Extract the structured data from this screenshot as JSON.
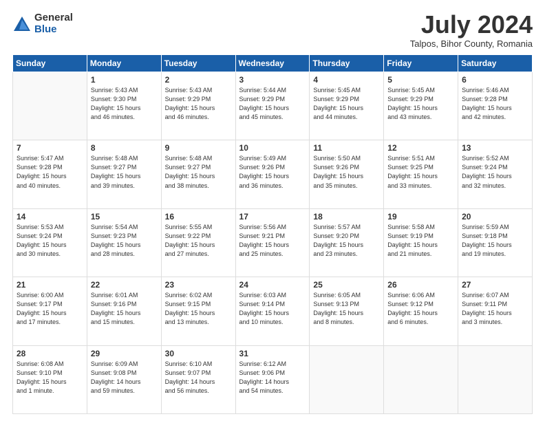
{
  "logo": {
    "general": "General",
    "blue": "Blue"
  },
  "header": {
    "month_year": "July 2024",
    "location": "Talpos, Bihor County, Romania"
  },
  "weekdays": [
    "Sunday",
    "Monday",
    "Tuesday",
    "Wednesday",
    "Thursday",
    "Friday",
    "Saturday"
  ],
  "weeks": [
    [
      {
        "day": "",
        "info": ""
      },
      {
        "day": "1",
        "info": "Sunrise: 5:43 AM\nSunset: 9:30 PM\nDaylight: 15 hours\nand 46 minutes."
      },
      {
        "day": "2",
        "info": "Sunrise: 5:43 AM\nSunset: 9:29 PM\nDaylight: 15 hours\nand 46 minutes."
      },
      {
        "day": "3",
        "info": "Sunrise: 5:44 AM\nSunset: 9:29 PM\nDaylight: 15 hours\nand 45 minutes."
      },
      {
        "day": "4",
        "info": "Sunrise: 5:45 AM\nSunset: 9:29 PM\nDaylight: 15 hours\nand 44 minutes."
      },
      {
        "day": "5",
        "info": "Sunrise: 5:45 AM\nSunset: 9:29 PM\nDaylight: 15 hours\nand 43 minutes."
      },
      {
        "day": "6",
        "info": "Sunrise: 5:46 AM\nSunset: 9:28 PM\nDaylight: 15 hours\nand 42 minutes."
      }
    ],
    [
      {
        "day": "7",
        "info": "Sunrise: 5:47 AM\nSunset: 9:28 PM\nDaylight: 15 hours\nand 40 minutes."
      },
      {
        "day": "8",
        "info": "Sunrise: 5:48 AM\nSunset: 9:27 PM\nDaylight: 15 hours\nand 39 minutes."
      },
      {
        "day": "9",
        "info": "Sunrise: 5:48 AM\nSunset: 9:27 PM\nDaylight: 15 hours\nand 38 minutes."
      },
      {
        "day": "10",
        "info": "Sunrise: 5:49 AM\nSunset: 9:26 PM\nDaylight: 15 hours\nand 36 minutes."
      },
      {
        "day": "11",
        "info": "Sunrise: 5:50 AM\nSunset: 9:26 PM\nDaylight: 15 hours\nand 35 minutes."
      },
      {
        "day": "12",
        "info": "Sunrise: 5:51 AM\nSunset: 9:25 PM\nDaylight: 15 hours\nand 33 minutes."
      },
      {
        "day": "13",
        "info": "Sunrise: 5:52 AM\nSunset: 9:24 PM\nDaylight: 15 hours\nand 32 minutes."
      }
    ],
    [
      {
        "day": "14",
        "info": "Sunrise: 5:53 AM\nSunset: 9:24 PM\nDaylight: 15 hours\nand 30 minutes."
      },
      {
        "day": "15",
        "info": "Sunrise: 5:54 AM\nSunset: 9:23 PM\nDaylight: 15 hours\nand 28 minutes."
      },
      {
        "day": "16",
        "info": "Sunrise: 5:55 AM\nSunset: 9:22 PM\nDaylight: 15 hours\nand 27 minutes."
      },
      {
        "day": "17",
        "info": "Sunrise: 5:56 AM\nSunset: 9:21 PM\nDaylight: 15 hours\nand 25 minutes."
      },
      {
        "day": "18",
        "info": "Sunrise: 5:57 AM\nSunset: 9:20 PM\nDaylight: 15 hours\nand 23 minutes."
      },
      {
        "day": "19",
        "info": "Sunrise: 5:58 AM\nSunset: 9:19 PM\nDaylight: 15 hours\nand 21 minutes."
      },
      {
        "day": "20",
        "info": "Sunrise: 5:59 AM\nSunset: 9:18 PM\nDaylight: 15 hours\nand 19 minutes."
      }
    ],
    [
      {
        "day": "21",
        "info": "Sunrise: 6:00 AM\nSunset: 9:17 PM\nDaylight: 15 hours\nand 17 minutes."
      },
      {
        "day": "22",
        "info": "Sunrise: 6:01 AM\nSunset: 9:16 PM\nDaylight: 15 hours\nand 15 minutes."
      },
      {
        "day": "23",
        "info": "Sunrise: 6:02 AM\nSunset: 9:15 PM\nDaylight: 15 hours\nand 13 minutes."
      },
      {
        "day": "24",
        "info": "Sunrise: 6:03 AM\nSunset: 9:14 PM\nDaylight: 15 hours\nand 10 minutes."
      },
      {
        "day": "25",
        "info": "Sunrise: 6:05 AM\nSunset: 9:13 PM\nDaylight: 15 hours\nand 8 minutes."
      },
      {
        "day": "26",
        "info": "Sunrise: 6:06 AM\nSunset: 9:12 PM\nDaylight: 15 hours\nand 6 minutes."
      },
      {
        "day": "27",
        "info": "Sunrise: 6:07 AM\nSunset: 9:11 PM\nDaylight: 15 hours\nand 3 minutes."
      }
    ],
    [
      {
        "day": "28",
        "info": "Sunrise: 6:08 AM\nSunset: 9:10 PM\nDaylight: 15 hours\nand 1 minute."
      },
      {
        "day": "29",
        "info": "Sunrise: 6:09 AM\nSunset: 9:08 PM\nDaylight: 14 hours\nand 59 minutes."
      },
      {
        "day": "30",
        "info": "Sunrise: 6:10 AM\nSunset: 9:07 PM\nDaylight: 14 hours\nand 56 minutes."
      },
      {
        "day": "31",
        "info": "Sunrise: 6:12 AM\nSunset: 9:06 PM\nDaylight: 14 hours\nand 54 minutes."
      },
      {
        "day": "",
        "info": ""
      },
      {
        "day": "",
        "info": ""
      },
      {
        "day": "",
        "info": ""
      }
    ]
  ]
}
